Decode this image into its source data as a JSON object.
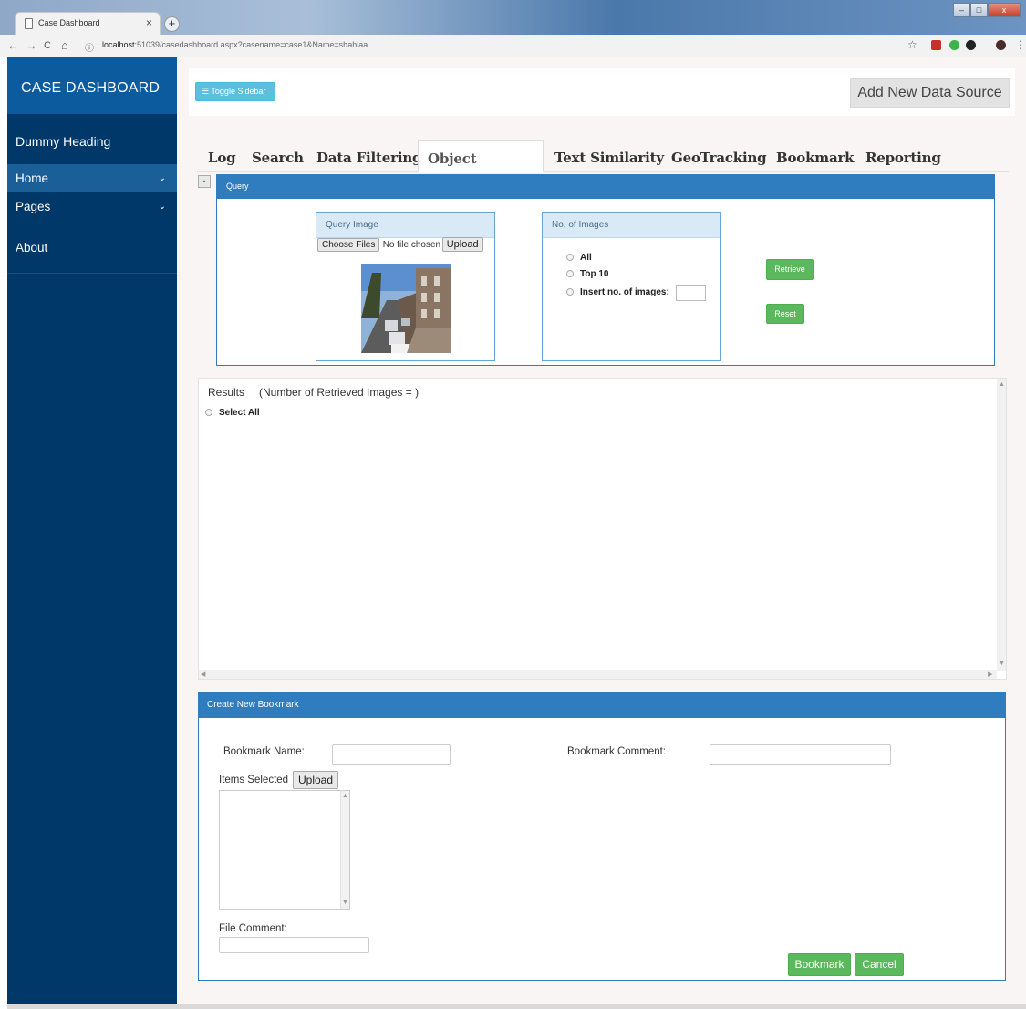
{
  "browser": {
    "tab_title": "Case Dashboard",
    "tab_close": "×",
    "new_tab": "+",
    "url_host": "localhost",
    "url_rest": ":51039/casedashboard.aspx?casename=case1&Name=shahlaa",
    "back": "←",
    "forward": "→",
    "reload": "C",
    "home": "⌂",
    "info": "ⓘ",
    "star": "☆",
    "menu": "⋮"
  },
  "sidebar": {
    "title": "CASE DASHBOARD",
    "heading": "Dummy Heading",
    "items": [
      {
        "label": "Home",
        "chevron": "⌄"
      },
      {
        "label": "Pages",
        "chevron": "⌄"
      },
      {
        "label": "About"
      }
    ]
  },
  "topbar": {
    "toggle_label": "Toggle Sidebar",
    "toggle_icon": "☰",
    "add_source_label": "Add New Data Source"
  },
  "tabs": [
    {
      "label": "Log"
    },
    {
      "label": "Search"
    },
    {
      "label": "Data Filtering"
    },
    {
      "label": "Object Matching",
      "active": true
    },
    {
      "label": "Text Similarity"
    },
    {
      "label": "GeoTracking"
    },
    {
      "label": "Bookmark"
    },
    {
      "label": "Reporting"
    }
  ],
  "query": {
    "collapse": "-",
    "title": "Query",
    "query_image": {
      "title": "Query Image",
      "choose_files": "Choose Files",
      "no_file": "No file chosen",
      "upload": "Upload"
    },
    "num_images": {
      "title": "No. of Images",
      "options": [
        "All",
        "Top 10",
        "Insert no. of images:"
      ],
      "custom_value": ""
    },
    "retrieve_label": "Retrieve",
    "reset_label": "Reset"
  },
  "results": {
    "title": "Results",
    "count_text": "(Number of Retrieved Images = )",
    "select_all": "Select All"
  },
  "bookmark": {
    "title": "Create New Bookmark",
    "name_label": "Bookmark Name:",
    "name_value": "",
    "comment_label": "Bookmark Comment:",
    "comment_value": "",
    "items_label": "Items Selected",
    "upload": "Upload",
    "file_comment_label": "File Comment:",
    "file_comment_value": "",
    "bookmark_btn": "Bookmark",
    "cancel_btn": "Cancel"
  },
  "colors": {
    "sidebar": "#00386a",
    "sidebar_header": "#0c5b9e",
    "panel_header": "#2f7cbf",
    "green": "#5cb85c",
    "info": "#5bc0de"
  }
}
